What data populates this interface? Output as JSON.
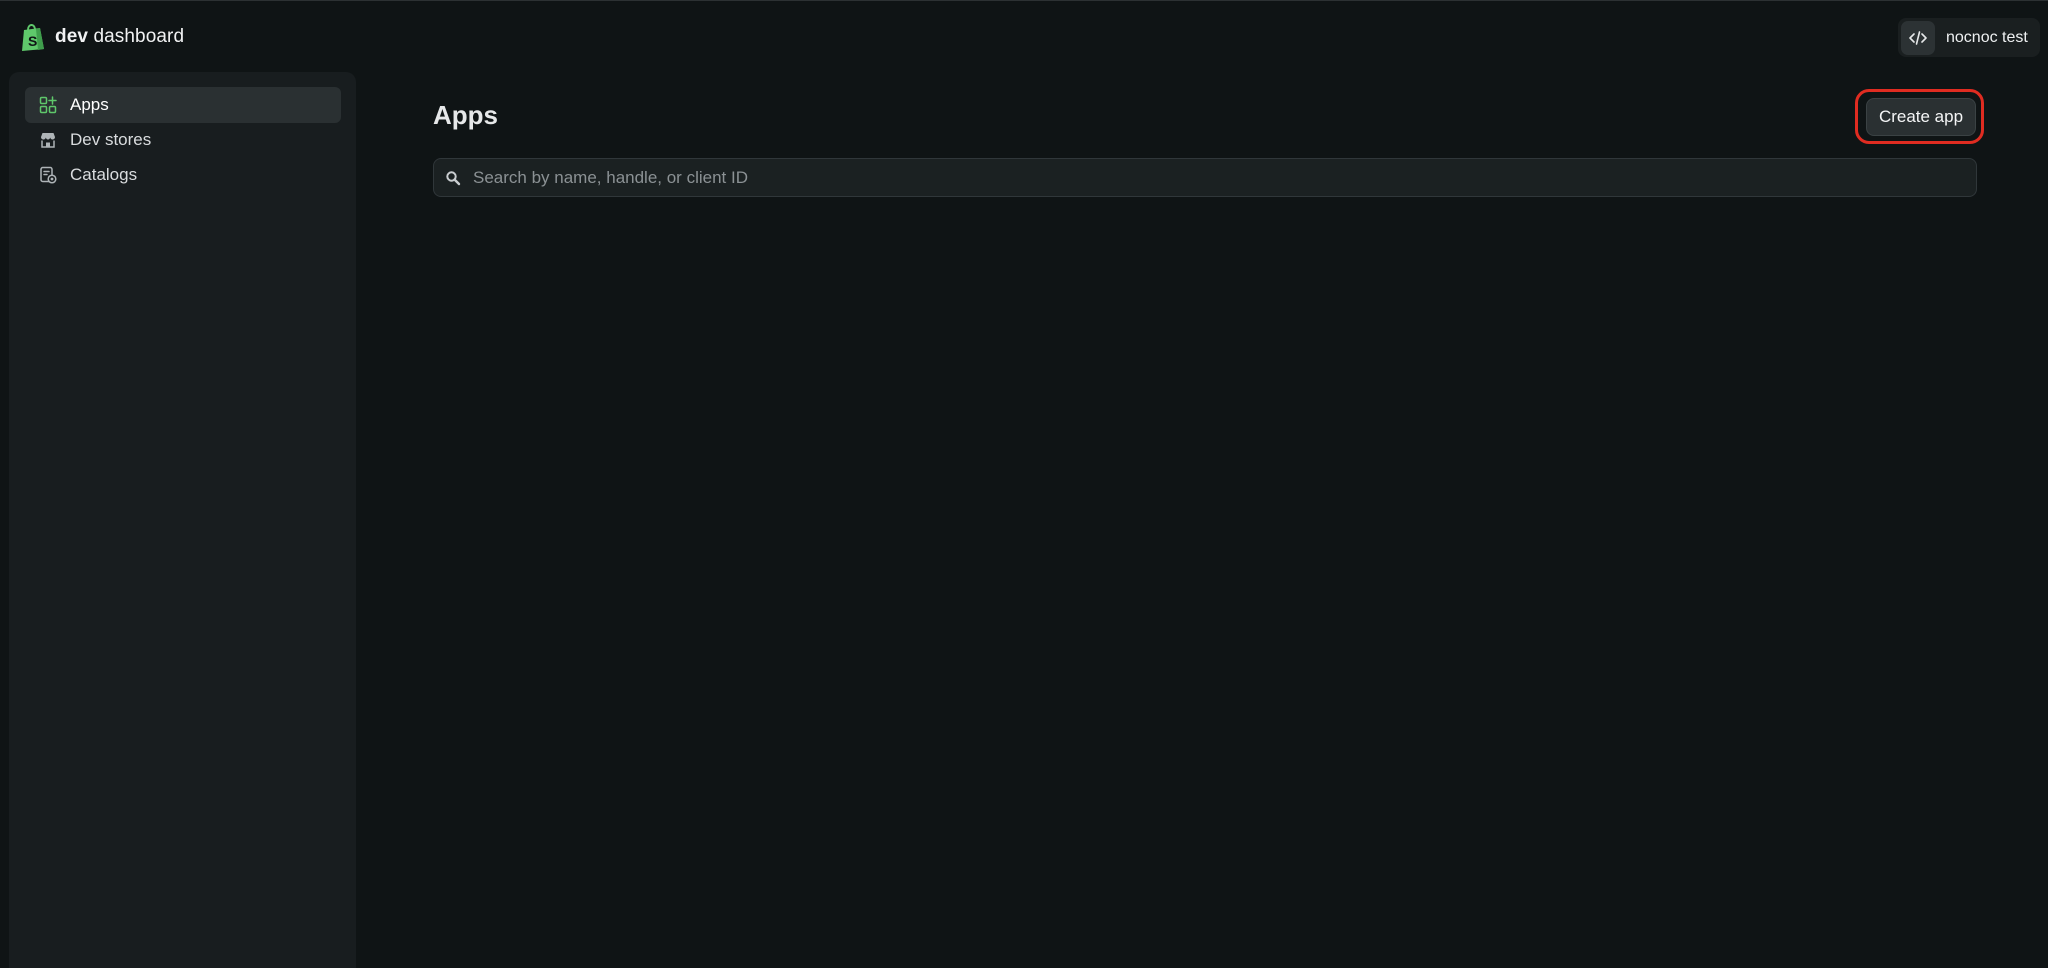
{
  "header": {
    "brand_bold": "dev",
    "brand_rest": "dashboard",
    "logo_icon": "shopify-bag-icon",
    "account_icon": "code-icon",
    "account_name": "nocnoc test"
  },
  "sidebar": {
    "items": [
      {
        "label": "Apps",
        "icon": "apps-grid-plus-icon",
        "active": true
      },
      {
        "label": "Dev stores",
        "icon": "store-icon",
        "active": false
      },
      {
        "label": "Catalogs",
        "icon": "catalog-icon",
        "active": false
      }
    ]
  },
  "main": {
    "title": "Apps",
    "create_button_label": "Create app",
    "search": {
      "placeholder": "Search by name, handle, or client ID",
      "value": ""
    }
  },
  "colors": {
    "background": "#0f1415",
    "sidebar": "#181d1f",
    "accent_green": "#5fc86b",
    "highlight_ring": "#e02c21"
  }
}
